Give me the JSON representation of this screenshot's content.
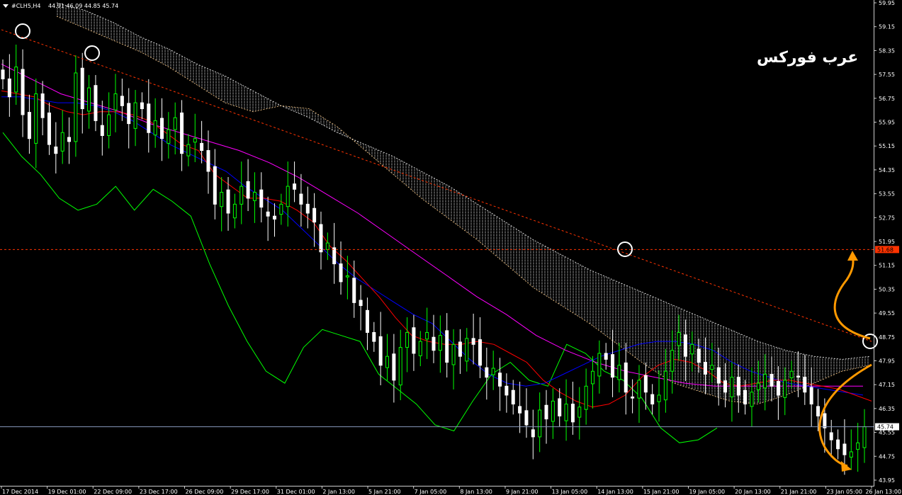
{
  "header": {
    "symbol_label": "#CLH5,H4",
    "ohlc_label": "44.91 46.09 44.85 45.74"
  },
  "watermark": "عرب فوركس",
  "price_tags": {
    "resistance": "51.68",
    "current": "45.74"
  },
  "colors": {
    "background": "#000000",
    "bull_candle": "#00ff00",
    "bear_candle": "#ffffff",
    "tenkan": "#ff0000",
    "kijun": "#0000ff",
    "chikou": "#00ff00",
    "ma": "#ff00ff",
    "cloud": "#ffffff",
    "resistance": "#ff3300",
    "arrows": "#ff9900"
  },
  "chart_data": {
    "type": "candlestick",
    "title": "",
    "ylim": [
      43.95,
      59.95
    ],
    "y_ticks": [
      "59.95",
      "59.15",
      "58.35",
      "57.55",
      "56.75",
      "55.95",
      "55.15",
      "54.35",
      "53.55",
      "52.75",
      "51.95",
      "51.15",
      "50.35",
      "49.55",
      "48.75",
      "47.95",
      "47.15",
      "46.35",
      "45.55",
      "44.75",
      "43.95"
    ],
    "x_labels": [
      "17 Dec 2014",
      "19 Dec 01:00",
      "22 Dec 09:00",
      "23 Dec 17:00",
      "26 Dec 09:00",
      "29 Dec 17:00",
      "31 Dec 01:00",
      "2 Jan 13:00",
      "5 Jan 21:00",
      "7 Jan 05:00",
      "8 Jan 13:00",
      "9 Jan 21:00",
      "13 Jan 05:00",
      "14 Jan 13:00",
      "15 Jan 21:00",
      "19 Jan 05:00",
      "20 Jan 13:00",
      "21 Jan 21:00",
      "23 Jan 05:00",
      "26 Jan 13:00"
    ],
    "closes": [
      57.4,
      56.8,
      57.8,
      56.2,
      55.4,
      56.9,
      56.1,
      55.2,
      54.9,
      55.6,
      55.3,
      57.6,
      56.4,
      57.1,
      56.0,
      55.5,
      56.2,
      56.9,
      56.5,
      55.9,
      56.6,
      56.4,
      55.6,
      56.0,
      55.4,
      55.7,
      56.1,
      54.9,
      55.2,
      55.4,
      55.0,
      54.3,
      53.2,
      53.6,
      52.9,
      53.2,
      53.8,
      53.4,
      53.6,
      53.1,
      52.8,
      52.7,
      53.2,
      53.8,
      53.7,
      53.2,
      52.9,
      52.6,
      51.6,
      51.9,
      51.2,
      50.6,
      50.8,
      49.9,
      49.8,
      48.9,
      48.6,
      47.8,
      48.1,
      47.3,
      48.4,
      48.9,
      48.2,
      48.6,
      48.9,
      48.3,
      48.8,
      47.9,
      48.5,
      48.1,
      48.7,
      48.5,
      47.8,
      47.4,
      47.7,
      47.1,
      46.8,
      46.5,
      46.2,
      45.8,
      45.4,
      46.3,
      46.0,
      46.6,
      46.1,
      46.5,
      45.9,
      46.4,
      47.1,
      47.6,
      48.2,
      48.0,
      47.4,
      47.8,
      46.9,
      46.7,
      47.3,
      46.9,
      46.5,
      46.8,
      47.6,
      48.3,
      48.9,
      48.1,
      48.5,
      47.9,
      47.5,
      47.8,
      47.2,
      46.9,
      47.4,
      46.8,
      46.5,
      46.9,
      47.2,
      47.5,
      47.1,
      46.8,
      47.3,
      47.6,
      47.4,
      46.9,
      46.5,
      46.1,
      45.7,
      45.3,
      45.0,
      44.8,
      44.9,
      45.2,
      45.74
    ],
    "tenkan": [
      57.0,
      56.9,
      56.8,
      56.5,
      56.3,
      56.2,
      56.3,
      56.3,
      56.2,
      56.0,
      55.6,
      55.2,
      55.0,
      54.2,
      53.8,
      53.4,
      53.4,
      53.3,
      53.0,
      52.6,
      51.8,
      51.3,
      50.7,
      50.1,
      49.4,
      48.8,
      48.6,
      48.5,
      48.5,
      48.6,
      48.5,
      48.2,
      47.9,
      47.3,
      46.9,
      46.6,
      46.4,
      46.5,
      46.8,
      47.4,
      47.8,
      48.0,
      47.9,
      47.6,
      47.2,
      47.1,
      47.2,
      47.3,
      47.3,
      47.2,
      47.1,
      47.0,
      46.8,
      46.6
    ],
    "kijun": [
      56.8,
      56.8,
      56.7,
      56.6,
      56.6,
      56.5,
      56.3,
      56.0,
      55.6,
      55.2,
      54.9,
      54.6,
      54.3,
      53.8,
      53.4,
      53.0,
      52.4,
      51.8,
      51.2,
      50.7,
      50.3,
      49.9,
      49.5,
      49.2,
      48.6,
      48.0,
      47.5,
      47.2,
      47.1,
      47.2,
      47.5,
      47.8,
      48.1,
      48.3,
      48.5,
      48.6,
      48.6,
      48.5,
      48.3,
      47.9,
      47.6,
      47.4,
      47.2,
      47.1,
      47.0,
      46.9,
      46.8
    ],
    "chikou": [
      55.6,
      54.8,
      54.2,
      53.4,
      53.0,
      53.2,
      53.8,
      53.0,
      53.7,
      53.3,
      52.8,
      51.2,
      49.8,
      48.6,
      47.6,
      47.2,
      48.4,
      49.0,
      48.8,
      48.6,
      47.5,
      47.0,
      46.5,
      45.8,
      45.6,
      46.6,
      47.5,
      47.9,
      47.3,
      47.1,
      48.5,
      48.2,
      47.6,
      47.3,
      46.7,
      45.7,
      45.2,
      45.3,
      45.7
    ],
    "moving_average": [
      57.9,
      57.4,
      56.9,
      56.6,
      56.3,
      55.9,
      55.6,
      55.3,
      55.0,
      54.6,
      54.1,
      53.5,
      52.9,
      52.2,
      51.5,
      50.8,
      50.1,
      49.5,
      48.8,
      48.3,
      47.9,
      47.6,
      47.4,
      47.2,
      47.1,
      47.1,
      47.1,
      47.1,
      47.1,
      47.1
    ],
    "cloud_top": [
      59.95,
      59.7,
      59.3,
      58.8,
      58.4,
      57.9,
      57.5,
      57.0,
      56.5,
      56.1,
      55.6,
      55.2,
      54.8,
      54.3,
      53.8,
      53.2,
      52.6,
      52.0,
      51.5,
      51.0,
      50.6,
      50.2,
      49.8,
      49.4,
      49.0,
      48.6,
      48.3,
      48.1,
      48.0,
      48.1
    ],
    "cloud_bottom": [
      59.5,
      59.1,
      58.7,
      58.3,
      57.8,
      57.2,
      56.6,
      56.3,
      56.5,
      56.4,
      55.8,
      55.0,
      54.2,
      53.4,
      52.7,
      52.0,
      51.2,
      50.4,
      49.8,
      49.2,
      48.5,
      47.8,
      47.2,
      46.9,
      46.6,
      46.5,
      46.8,
      47.2,
      47.6,
      47.8
    ],
    "resistance_level": 51.68,
    "current_price": 45.74,
    "trendline": [
      {
        "x": 0,
        "y": 59.05
      },
      {
        "x": 1,
        "y": 48.6
      }
    ]
  }
}
